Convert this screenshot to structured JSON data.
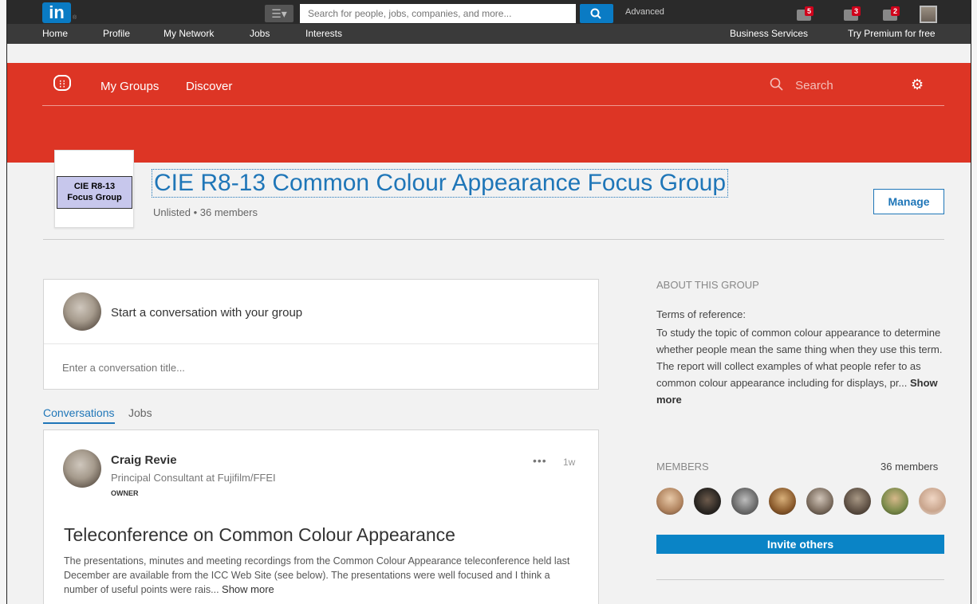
{
  "linkedin": {
    "logo_text": "in",
    "logo_suffix": "®",
    "search_placeholder": "Search for people, jobs, companies, and more...",
    "advanced_label": "Advanced",
    "badges": {
      "messages": "5",
      "notifications": "3",
      "connections": "2"
    }
  },
  "nav": {
    "items": [
      "Home",
      "Profile",
      "My Network",
      "Jobs",
      "Interests"
    ],
    "right": [
      "Business Services",
      "Try Premium for free"
    ]
  },
  "groups_nav": {
    "my_groups": "My Groups",
    "discover": "Discover",
    "search": "Search"
  },
  "group": {
    "logo_line1": "CIE R8-13",
    "logo_line2": "Focus Group",
    "title": "CIE R8-13 Common Colour Appearance Focus Group",
    "meta": "Unlisted • 36 members",
    "manage_label": "Manage"
  },
  "composer": {
    "prompt": "Start a conversation with your group",
    "title_placeholder": "Enter a conversation title..."
  },
  "tabs": [
    "Conversations",
    "Jobs"
  ],
  "post": {
    "author": "Craig Revie",
    "author_title": "Principal Consultant at Fujifilm/FFEI",
    "role": "OWNER",
    "menu": "•••",
    "ago": "1w",
    "title": "Teleconference on Common Colour Appearance",
    "body": "The presentations, minutes and meeting recordings from the Common Colour Appearance teleconference held last December are available from the ICC Web Site (see below). The presentations were well focused and I think a number of useful points were rais...",
    "show_more": "Show more"
  },
  "about": {
    "heading": "ABOUT THIS GROUP",
    "label": "Terms of reference:",
    "text": "To study the topic of common colour appearance to determine whether people mean the same thing when they use this term. The report will collect examples of what people refer to as common colour appearance including for displays, pr...",
    "show_more": "Show more"
  },
  "members": {
    "heading": "MEMBERS",
    "count": "36 members",
    "invite_label": "Invite others"
  },
  "colors": {
    "brand_red": "#dd3525",
    "link_blue": "#1f76b8",
    "button_blue": "#0a84c6"
  }
}
